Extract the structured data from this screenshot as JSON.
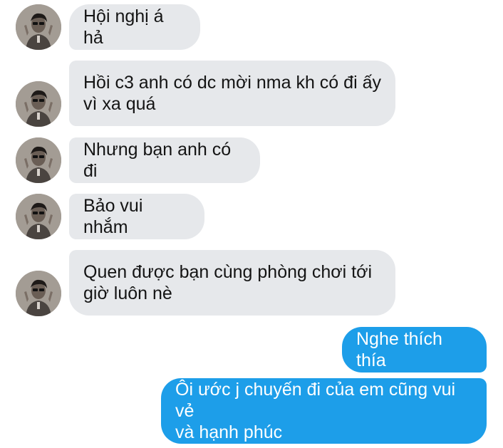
{
  "conversation": {
    "messages": [
      {
        "sender": "contact",
        "text": "Hội nghị á hả"
      },
      {
        "sender": "contact",
        "text": "Hồi c3 anh có dc mời nma kh có đi ấy\nvì xa quá"
      },
      {
        "sender": "contact",
        "text": "Nhưng bạn anh có đi"
      },
      {
        "sender": "contact",
        "text": "Bảo vui nhắm"
      },
      {
        "sender": "contact",
        "text": "Quen được bạn cùng phòng chơi tới\ngiờ luôn nè"
      },
      {
        "sender": "me",
        "text": "Nghe thích thía"
      },
      {
        "sender": "me",
        "text": "Ôi ước j chuyến đi của em cũng vui vẻ\nvà hạnh phúc"
      }
    ]
  },
  "colors": {
    "incoming_bubble": "#e6e8eb",
    "outgoing_bubble": "#1d9ee9",
    "incoming_text": "#141414",
    "outgoing_text": "#ffffff"
  },
  "icons": {
    "contact_avatar": "profile-photo-avatar"
  }
}
